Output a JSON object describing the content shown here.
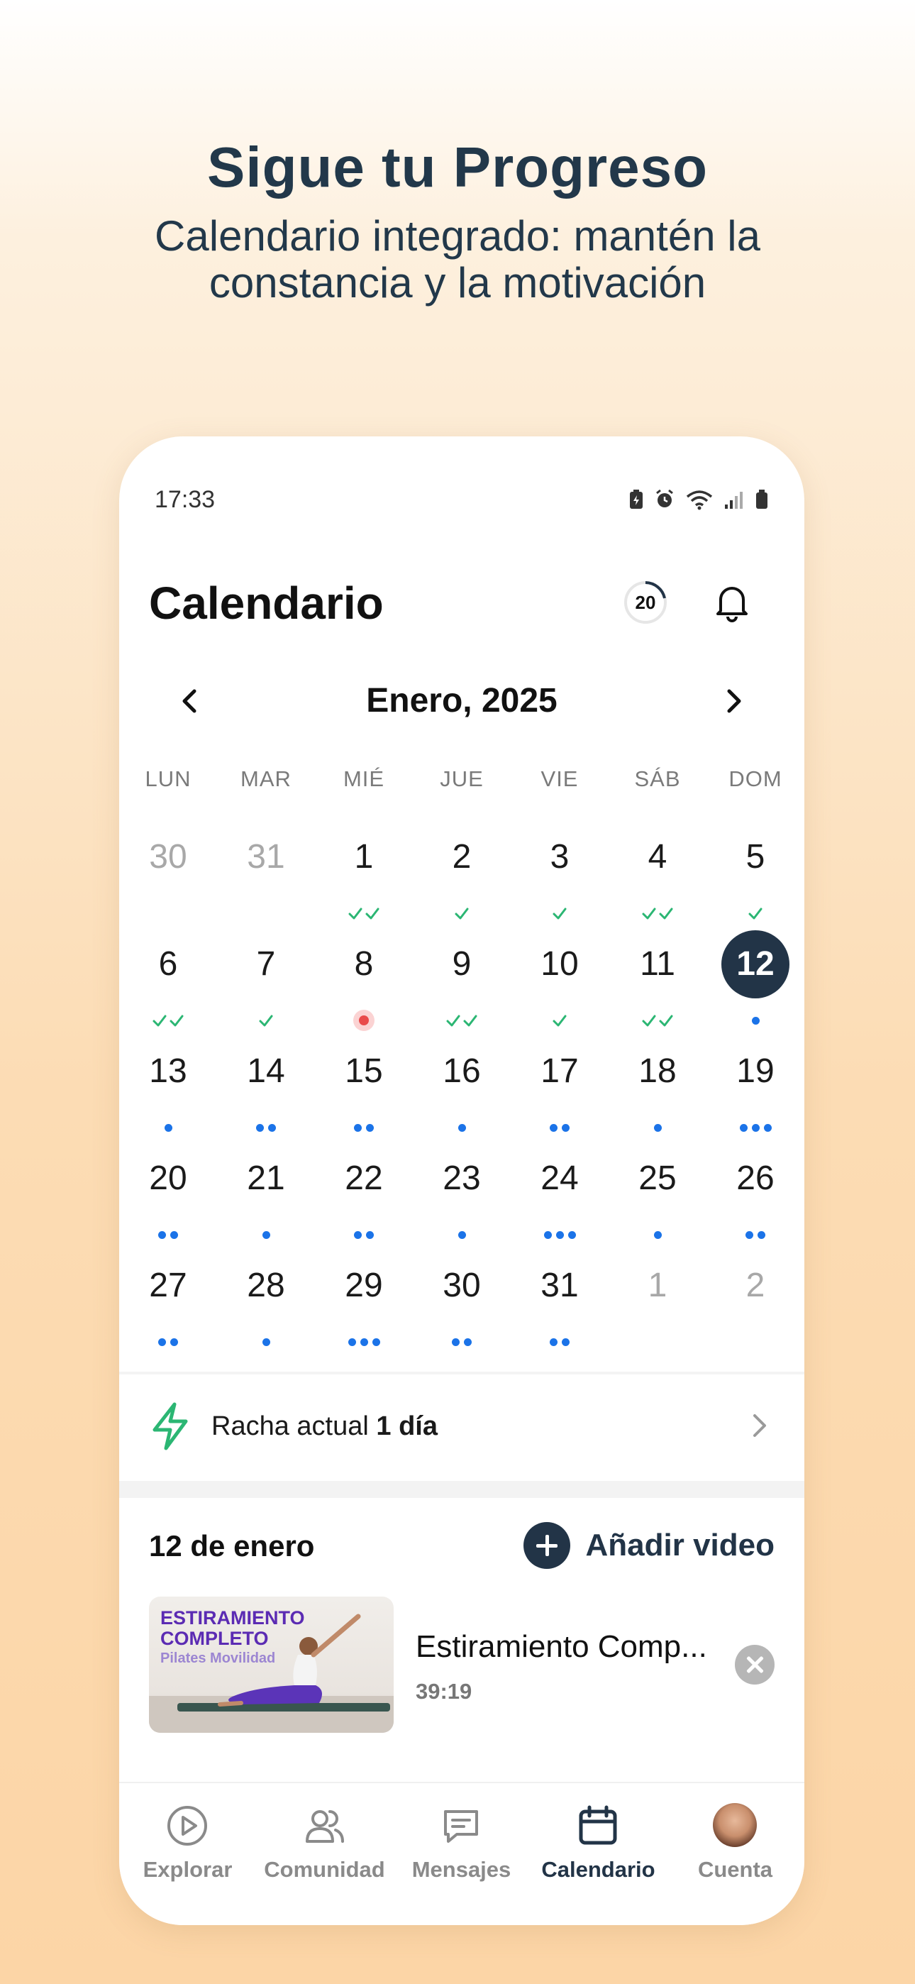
{
  "hero": {
    "title": "Sigue tu Progreso",
    "subtitle": "Calendario integrado: mantén la constancia y la motivación"
  },
  "status_bar": {
    "time": "17:33"
  },
  "header": {
    "title": "Calendario",
    "streak_ring_value": "20"
  },
  "calendar": {
    "month_label": "Enero, 2025",
    "weekdays": [
      "LUN",
      "MAR",
      "MIÉ",
      "JUE",
      "VIE",
      "SÁB",
      "DOM"
    ],
    "weeks": [
      [
        {
          "d": "30",
          "other": true
        },
        {
          "d": "31",
          "other": true
        },
        {
          "d": "1",
          "mark": "check2"
        },
        {
          "d": "2",
          "mark": "check1"
        },
        {
          "d": "3",
          "mark": "check1"
        },
        {
          "d": "4",
          "mark": "check2"
        },
        {
          "d": "5",
          "mark": "check1"
        }
      ],
      [
        {
          "d": "6",
          "mark": "check2"
        },
        {
          "d": "7",
          "mark": "check1"
        },
        {
          "d": "8",
          "mark": "miss"
        },
        {
          "d": "9",
          "mark": "check2"
        },
        {
          "d": "10",
          "mark": "check1"
        },
        {
          "d": "11",
          "mark": "check2"
        },
        {
          "d": "12",
          "today": true,
          "mark": "dot1"
        }
      ],
      [
        {
          "d": "13",
          "mark": "dot1"
        },
        {
          "d": "14",
          "mark": "dot2"
        },
        {
          "d": "15",
          "mark": "dot2"
        },
        {
          "d": "16",
          "mark": "dot1"
        },
        {
          "d": "17",
          "mark": "dot2"
        },
        {
          "d": "18",
          "mark": "dot1"
        },
        {
          "d": "19",
          "mark": "dot3"
        }
      ],
      [
        {
          "d": "20",
          "mark": "dot2"
        },
        {
          "d": "21",
          "mark": "dot1"
        },
        {
          "d": "22",
          "mark": "dot2"
        },
        {
          "d": "23",
          "mark": "dot1"
        },
        {
          "d": "24",
          "mark": "dot3"
        },
        {
          "d": "25",
          "mark": "dot1"
        },
        {
          "d": "26",
          "mark": "dot2"
        }
      ],
      [
        {
          "d": "27",
          "mark": "dot2"
        },
        {
          "d": "28",
          "mark": "dot1"
        },
        {
          "d": "29",
          "mark": "dot3"
        },
        {
          "d": "30",
          "mark": "dot2"
        },
        {
          "d": "31",
          "mark": "dot2"
        },
        {
          "d": "1",
          "other": true
        },
        {
          "d": "2",
          "other": true
        }
      ]
    ]
  },
  "streak": {
    "label": "Racha actual",
    "value": "1 día"
  },
  "selected_day": {
    "title": "12 de enero",
    "add_video_label": "Añadir video",
    "video": {
      "thumb_title": "ESTIRAMIENTO COMPLETO",
      "thumb_subtitle": "Pilates Movilidad",
      "title": "Estiramiento Comp...",
      "duration": "39:19"
    }
  },
  "tabbar": {
    "tabs": [
      {
        "label": "Explorar",
        "icon": "play-circle-icon"
      },
      {
        "label": "Comunidad",
        "icon": "users-icon"
      },
      {
        "label": "Mensajes",
        "icon": "message-icon"
      },
      {
        "label": "Calendario",
        "icon": "calendar-icon",
        "active": true
      },
      {
        "label": "Cuenta",
        "icon": "avatar"
      }
    ]
  },
  "colors": {
    "accent_dark": "#223447",
    "check_green": "#2bb673",
    "dot_blue": "#1b73e8",
    "miss_red": "#e94b4b"
  }
}
